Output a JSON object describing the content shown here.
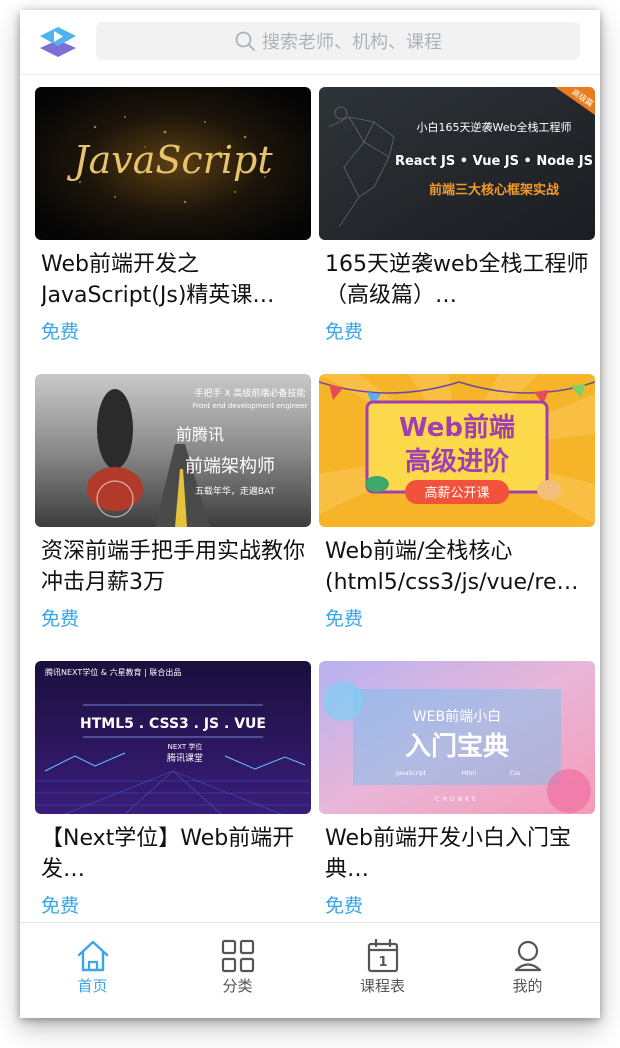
{
  "header": {
    "search_placeholder": "搜索老师、机构、课程"
  },
  "courses": [
    {
      "title": "Web前端开发之JavaScript(Js)精英课…",
      "price": "免费",
      "thumb_text": "JavaScript"
    },
    {
      "title": "165天逆袭web全栈工程师（高级篇）…",
      "price": "免费",
      "thumb_lines": [
        "小白165天逆袭Web全栈工程师",
        "React JS • Vue JS • Node JS",
        "前端三大核心框架实战"
      ],
      "corner_tag": "高级篇"
    },
    {
      "title": "资深前端手把手用实战教你冲击月薪3万",
      "price": "免费",
      "thumb_lines": [
        "手把手 X 高级前端必备技能",
        "Front end development engineer",
        "前腾讯",
        "前端架构师",
        "五载年华，走遍BAT"
      ]
    },
    {
      "title": "Web前端/全栈核心(html5/css3/js/vue/re…",
      "price": "免费",
      "thumb_lines": [
        "Web前端",
        "高级进阶",
        "高薪公开课"
      ]
    },
    {
      "title": "【Next学位】Web前端开发…",
      "price": "免费",
      "thumb_lines": [
        "腾讯NEXT学位 & 六星教育 | 联合出品",
        "HTML5 . CSS3 . JS . VUE",
        "NEXT 学位",
        "腾讯课堂"
      ]
    },
    {
      "title": "Web前端开发小白入门宝典…",
      "price": "免费",
      "thumb_lines": [
        "WEB前端小白",
        "入门宝典",
        "JavaScript",
        "Html",
        "Css",
        "CHONKE"
      ]
    }
  ],
  "tabs": [
    {
      "label": "首页",
      "icon": "home-icon",
      "active": true
    },
    {
      "label": "分类",
      "icon": "grid-icon",
      "active": false
    },
    {
      "label": "课程表",
      "icon": "calendar-icon",
      "active": false
    },
    {
      "label": "我的",
      "icon": "user-icon",
      "active": false
    }
  ],
  "calendar_day": "1",
  "colors": {
    "accent": "#3aa5e8",
    "text": "#111111",
    "muted": "#555555"
  }
}
